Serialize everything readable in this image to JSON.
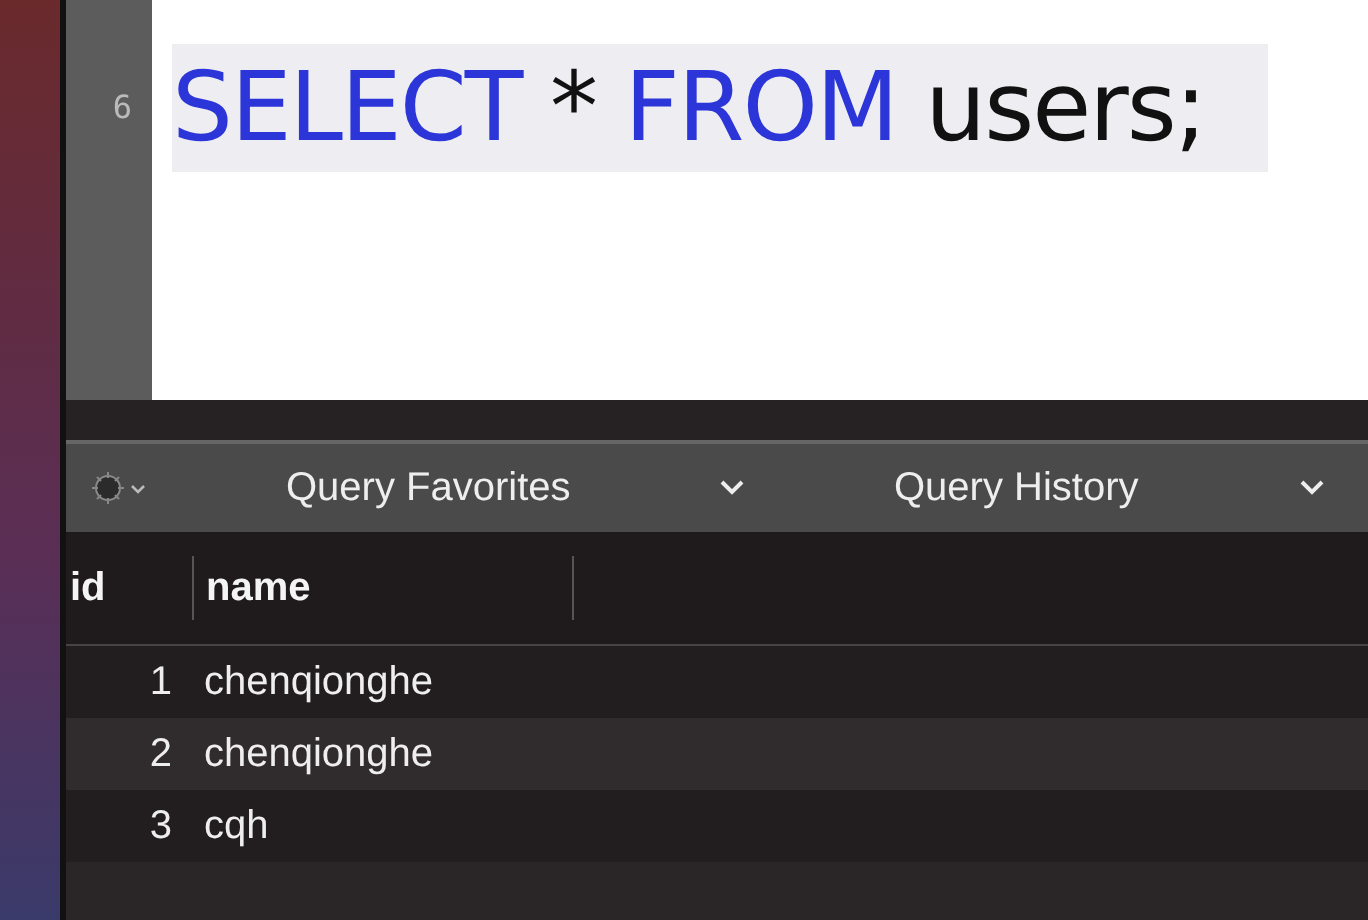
{
  "editor": {
    "lines": [
      {
        "number": "6",
        "selected": true,
        "tokens": [
          {
            "text": "SELECT",
            "kind": "keyword"
          },
          {
            "text": "*",
            "kind": "plain"
          },
          {
            "text": "FROM",
            "kind": "keyword"
          },
          {
            "text": "users;",
            "kind": "plain"
          }
        ]
      }
    ]
  },
  "toolbar": {
    "favorites": "Query Favorites",
    "history": "Query History"
  },
  "table": {
    "columns": [
      "id",
      "name"
    ],
    "rows": [
      {
        "cells": [
          "1",
          "chenqionghe"
        ]
      },
      {
        "cells": [
          "2",
          "chenqionghe"
        ]
      },
      {
        "cells": [
          "3",
          "cqh"
        ]
      }
    ]
  }
}
